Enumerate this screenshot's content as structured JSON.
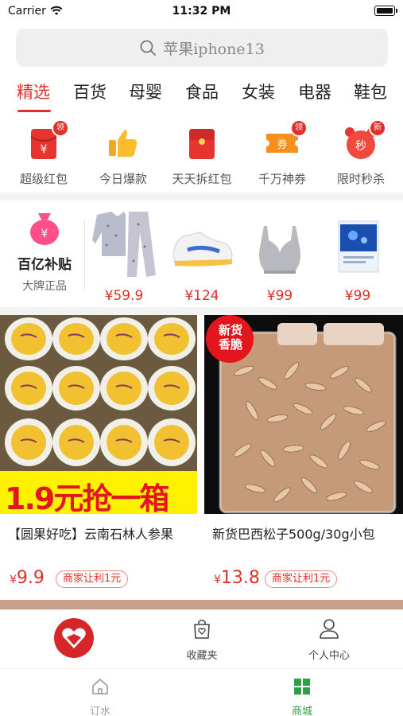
{
  "status": {
    "carrier": "Carrier",
    "time": "11:32 PM"
  },
  "search": {
    "placeholder": "苹果iphone13"
  },
  "tabs": [
    {
      "label": "精选",
      "active": true
    },
    {
      "label": "百货"
    },
    {
      "label": "母婴"
    },
    {
      "label": "食品"
    },
    {
      "label": "女装"
    },
    {
      "label": "电器"
    },
    {
      "label": "鞋包"
    }
  ],
  "quick_icons": [
    {
      "label": "超级红包",
      "icon": "red-envelope-icon",
      "badge": "领"
    },
    {
      "label": "今日爆款",
      "icon": "thumbs-up-icon",
      "badge": ""
    },
    {
      "label": "天天拆红包",
      "icon": "red-packet-icon",
      "badge": ""
    },
    {
      "label": "千万神券",
      "icon": "coupon-icon",
      "badge": "领"
    },
    {
      "label": "限时秒杀",
      "icon": "alarm-clock-icon",
      "badge": "新"
    }
  ],
  "subsidy": {
    "brand_name": "百亿补贴",
    "brand_sub": "大牌正品",
    "products": [
      {
        "price": "¥59.9",
        "image": "pajama-set"
      },
      {
        "price": "¥124",
        "image": "sneaker"
      },
      {
        "price": "¥99",
        "image": "bra"
      },
      {
        "price": "¥99",
        "image": "face-mask-box"
      }
    ]
  },
  "feed": [
    {
      "title": "【圆果好吃】云南石林人参果",
      "price_symbol": "¥",
      "price": "9.9",
      "promo": "商家让利1元",
      "banner_text": "1.9元抢一箱"
    },
    {
      "title": "新货巴西松子500g/30g小包",
      "price_symbol": "¥",
      "price": "13.8",
      "promo": "商家让利1元",
      "corner_line1": "新货",
      "corner_line2": "香脆"
    }
  ],
  "tabbar_upper": [
    {
      "label": "",
      "icon": "store-logo-icon"
    },
    {
      "label": "收藏夹",
      "icon": "favorites-bag-icon"
    },
    {
      "label": "个人中心",
      "icon": "user-icon"
    }
  ],
  "tabbar_lower": [
    {
      "label": "订水",
      "icon": "home-icon",
      "color": "#999999"
    },
    {
      "label": "商城",
      "icon": "grid-icon",
      "color": "#2ea043",
      "active": true
    }
  ],
  "colors": {
    "accent": "#e0302b",
    "active_green": "#2ea043"
  }
}
